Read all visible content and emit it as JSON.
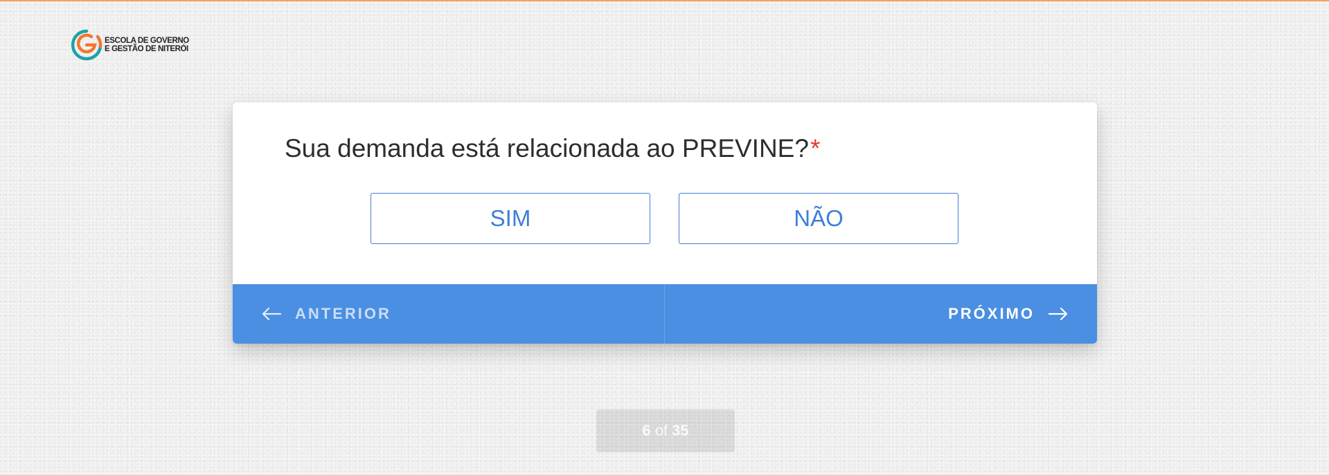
{
  "brand": {
    "logo_line1": "ESCOLA DE GOVERNO",
    "logo_line2": "E GESTÃO DE NITERÓI",
    "accent_orange": "#f2a25c",
    "accent_teal": "#1aa3a8"
  },
  "question": {
    "text": "Sua demanda está relacionada ao PREVINE?",
    "required_mark": "*"
  },
  "options": [
    {
      "label": "SIM"
    },
    {
      "label": "NÃO"
    }
  ],
  "navigation": {
    "previous_label": "ANTERIOR",
    "next_label": "PRÓXIMO",
    "previous_icon": "arrow-left-icon",
    "next_icon": "arrow-right-icon",
    "bar_color": "#4a8fe2"
  },
  "progress": {
    "current": "6",
    "separator": "of",
    "total": "35"
  }
}
